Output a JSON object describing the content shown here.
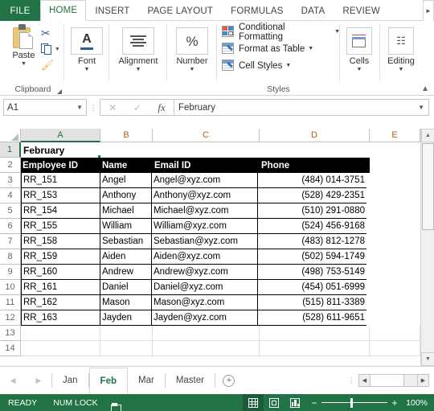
{
  "ribbon": {
    "tabs": [
      {
        "label": "FILE",
        "active": false,
        "file": true
      },
      {
        "label": "HOME",
        "active": true,
        "file": false
      },
      {
        "label": "INSERT",
        "active": false,
        "file": false
      },
      {
        "label": "PAGE LAYOUT",
        "active": false,
        "file": false
      },
      {
        "label": "FORMULAS",
        "active": false,
        "file": false
      },
      {
        "label": "DATA",
        "active": false,
        "file": false
      },
      {
        "label": "REVIEW",
        "active": false,
        "file": false
      }
    ],
    "tab_scroll_icon": "chevron-right-icon",
    "groups": {
      "clipboard": {
        "label": "Clipboard",
        "paste_label": "Paste",
        "cut_icon": "scissors-icon",
        "copy_icon": "copy-icon",
        "format_painter_icon": "format-painter-icon"
      },
      "font": {
        "label": "Font"
      },
      "alignment": {
        "label": "Alignment"
      },
      "number": {
        "label": "Number",
        "glyph": "%"
      },
      "styles": {
        "label": "Styles",
        "items": [
          {
            "label": "Conditional Formatting",
            "icon": "conditional-formatting-icon"
          },
          {
            "label": "Format as Table",
            "icon": "format-as-table-icon"
          },
          {
            "label": "Cell Styles",
            "icon": "cell-styles-icon"
          }
        ]
      },
      "cells": {
        "label": "Cells"
      },
      "editing": {
        "label": "Editing",
        "icon": "binoculars-icon"
      }
    },
    "collapse_icon": "chevron-up-icon"
  },
  "formula_bar": {
    "name_box_value": "A1",
    "name_box_caret": "chevron-down-icon",
    "cancel_icon": "close-icon",
    "enter_icon": "check-icon",
    "function_icon": "fx",
    "formula_value": "February",
    "expand_caret": "chevron-down-icon"
  },
  "sheet": {
    "columns": [
      "A",
      "B",
      "C",
      "D",
      "E"
    ],
    "selected_column": "A",
    "selected_row": 1,
    "row_numbers": [
      1,
      2,
      3,
      4,
      5,
      6,
      7,
      8,
      9,
      10,
      11,
      12,
      13,
      14
    ],
    "title_cell": "February",
    "header_row": [
      "Employee ID",
      "Name",
      "Email ID",
      "Phone"
    ],
    "rows": [
      {
        "id": "RR_151",
        "name": "Angel",
        "email": "Angel@xyz.com",
        "phone": "(484) 014-3751"
      },
      {
        "id": "RR_153",
        "name": "Anthony",
        "email": "Anthony@xyz.com",
        "phone": "(528) 429-2351"
      },
      {
        "id": "RR_154",
        "name": "Michael",
        "email": "Michael@xyz.com",
        "phone": "(510) 291-0880"
      },
      {
        "id": "RR_155",
        "name": "William",
        "email": "William@xyz.com",
        "phone": "(524) 456-9168"
      },
      {
        "id": "RR_158",
        "name": "Sebastian",
        "email": "Sebastian@xyz.com",
        "phone": "(483) 812-1278"
      },
      {
        "id": "RR_159",
        "name": "Aiden",
        "email": "Aiden@xyz.com",
        "phone": "(502) 594-1749"
      },
      {
        "id": "RR_160",
        "name": "Andrew",
        "email": "Andrew@xyz.com",
        "phone": "(498) 753-5149"
      },
      {
        "id": "RR_161",
        "name": "Daniel",
        "email": "Daniel@xyz.com",
        "phone": "(454) 051-6999"
      },
      {
        "id": "RR_162",
        "name": "Mason",
        "email": "Mason@xyz.com",
        "phone": "(515) 811-3389"
      },
      {
        "id": "RR_163",
        "name": "Jayden",
        "email": "Jayden@xyz.com",
        "phone": "(528) 611-9651"
      }
    ]
  },
  "sheet_tabs": {
    "prev_icon": "triangle-left-icon",
    "next_icon": "triangle-right-icon",
    "tabs": [
      {
        "label": "Jan",
        "active": false
      },
      {
        "label": "Feb",
        "active": true
      },
      {
        "label": "Mar",
        "active": false
      },
      {
        "label": "Master",
        "active": false
      }
    ],
    "add_sheet_label": "+"
  },
  "status_bar": {
    "mode": "READY",
    "num_lock": "NUM LOCK",
    "record_macro_icon": "record-macro-icon",
    "views": [
      {
        "name": "normal-view",
        "icon": "grid-icon",
        "active": true
      },
      {
        "name": "page-layout-view",
        "icon": "page-icon",
        "active": false
      },
      {
        "name": "page-break-view",
        "icon": "page-break-icon",
        "active": false
      }
    ],
    "zoom_out": "−",
    "zoom_in": "+",
    "zoom_level": "100%"
  },
  "colors": {
    "excel_green": "#217346",
    "header_black": "#000000",
    "column_header_text": "#b35c1e"
  }
}
